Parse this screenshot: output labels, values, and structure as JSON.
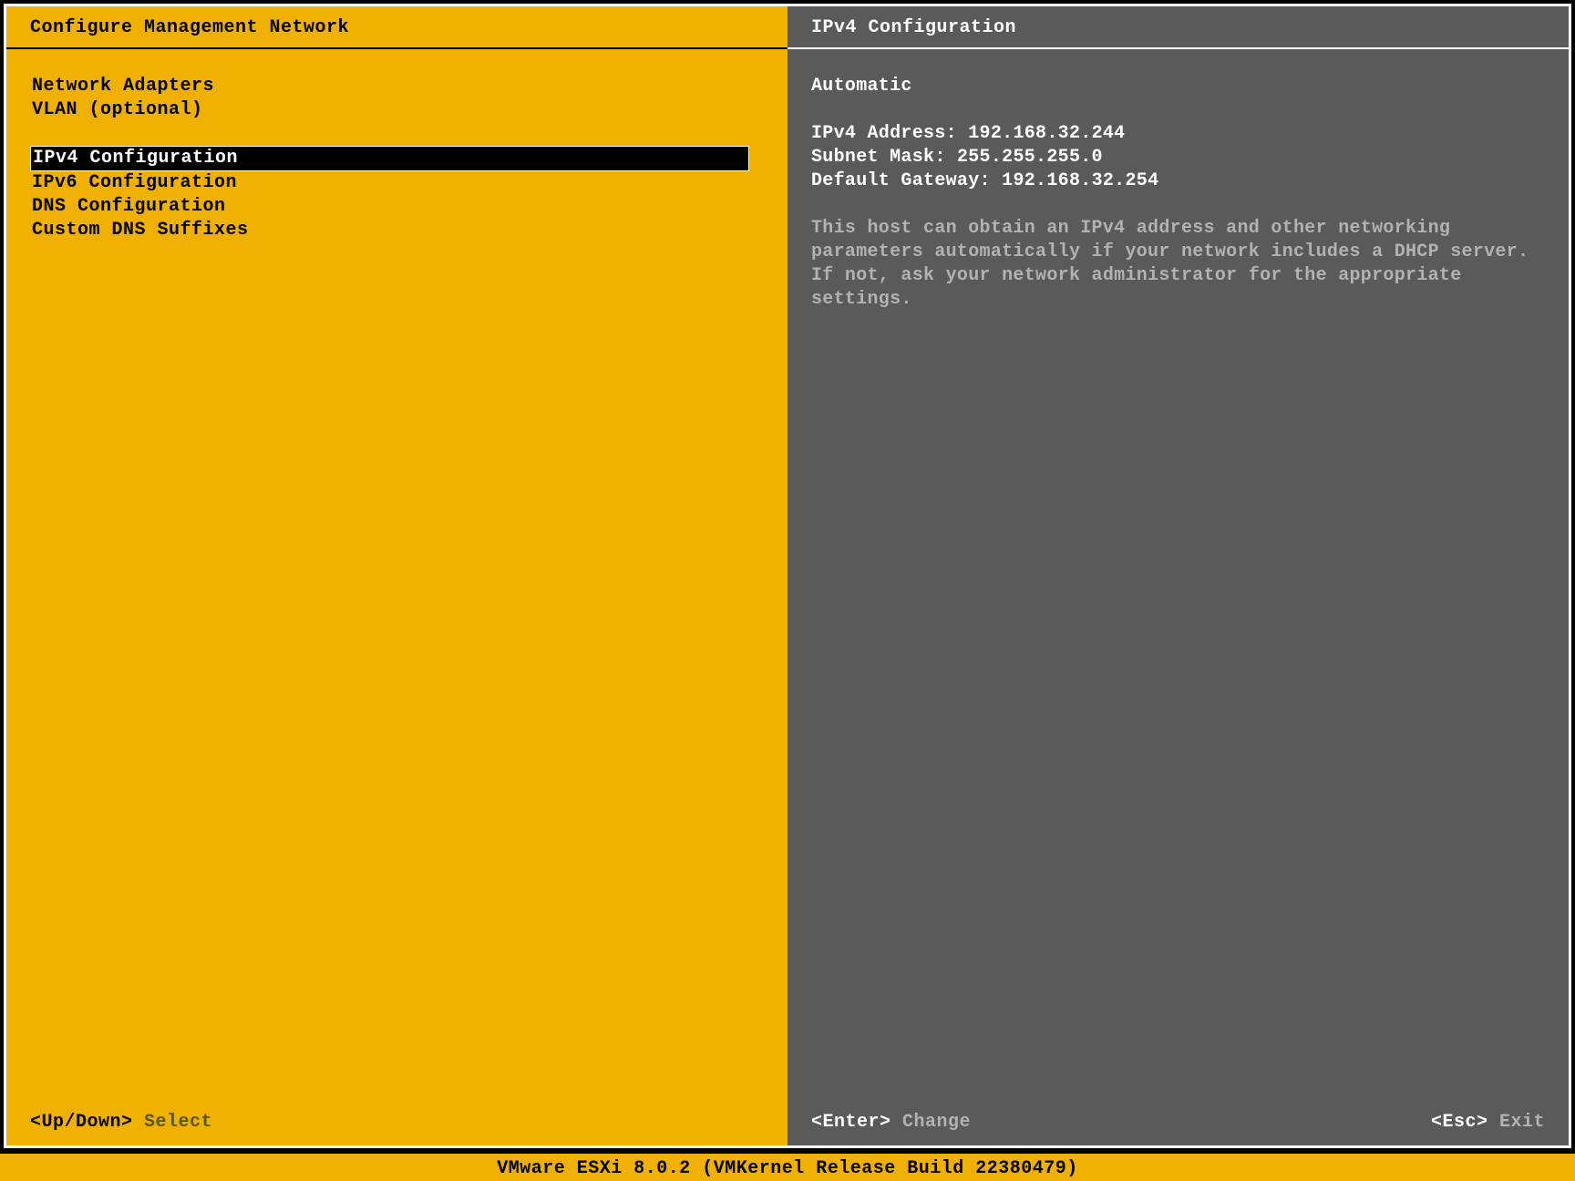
{
  "left": {
    "title": "Configure Management Network",
    "menu_groups": [
      [
        "Network Adapters",
        "VLAN (optional)"
      ],
      [
        "IPv4 Configuration",
        "IPv6 Configuration",
        "DNS Configuration",
        "Custom DNS Suffixes"
      ]
    ],
    "selected": "IPv4 Configuration",
    "footer": {
      "key": "<Up/Down>",
      "action": "Select"
    }
  },
  "right": {
    "title": "IPv4 Configuration",
    "mode": "Automatic",
    "ipv4_address_label": "IPv4 Address:",
    "ipv4_address_value": "192.168.32.244",
    "subnet_mask_label": "Subnet Mask:",
    "subnet_mask_value": "255.255.255.0",
    "default_gateway_label": "Default Gateway:",
    "default_gateway_value": "192.168.32.254",
    "help_text": "This host can obtain an IPv4 address and other networking parameters automatically if your network includes a DHCP server. If not, ask your network administrator for the appropriate settings.",
    "footer_left": {
      "key": "<Enter>",
      "action": "Change"
    },
    "footer_right": {
      "key": "<Esc>",
      "action": "Exit"
    }
  },
  "status_bar": "VMware ESXi 8.0.2 (VMKernel Release Build 22380479)"
}
